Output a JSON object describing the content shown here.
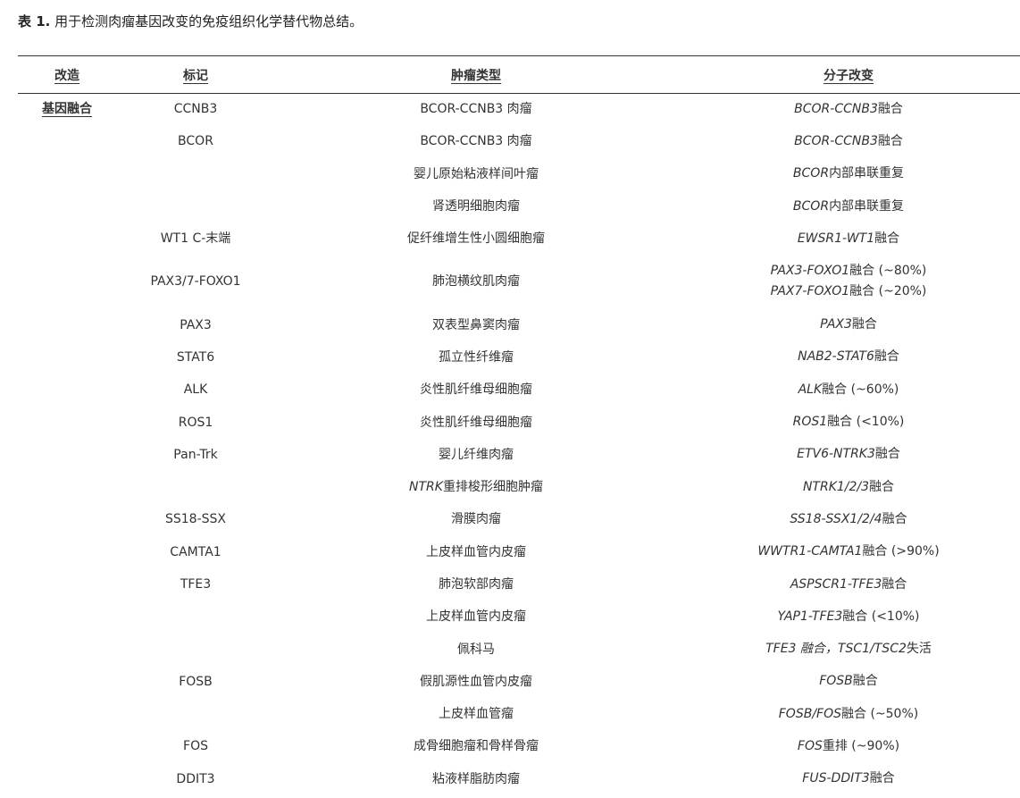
{
  "caption": {
    "label": "表 1.",
    "text": " 用于检测肉瘤基因改变的免疫组织化学替代物总结。"
  },
  "table": {
    "headers": [
      "改造",
      "标记",
      "肿瘤类型",
      "分子改变"
    ],
    "rows": [
      {
        "alteration": "基因融合",
        "marker": "CCNB3",
        "tumor": [
          {
            "t": "BCOR-CCNB3 肉瘤",
            "i": false
          }
        ],
        "molecular": [
          [
            {
              "t": "BCOR-CCNB3",
              "i": true
            },
            {
              "t": "融合",
              "i": false
            }
          ]
        ]
      },
      {
        "alteration": "",
        "marker": "BCOR",
        "tumor": [
          {
            "t": "BCOR-CCNB3 肉瘤",
            "i": false
          }
        ],
        "molecular": [
          [
            {
              "t": "BCOR-CCNB3",
              "i": true
            },
            {
              "t": "融合",
              "i": false
            }
          ]
        ]
      },
      {
        "alteration": "",
        "marker": "",
        "tumor": [
          {
            "t": "婴儿原始粘液样间叶瘤",
            "i": false
          }
        ],
        "molecular": [
          [
            {
              "t": "BCOR",
              "i": true
            },
            {
              "t": "内部串联重复",
              "i": false
            }
          ]
        ]
      },
      {
        "alteration": "",
        "marker": "",
        "tumor": [
          {
            "t": "肾透明细胞肉瘤",
            "i": false
          }
        ],
        "molecular": [
          [
            {
              "t": "BCOR",
              "i": true
            },
            {
              "t": "内部串联重复",
              "i": false
            }
          ]
        ]
      },
      {
        "alteration": "",
        "marker": "WT1 C-末端",
        "tumor": [
          {
            "t": "促纤维增生性小圆细胞瘤",
            "i": false
          }
        ],
        "molecular": [
          [
            {
              "t": "EWSR1-WT1",
              "i": true
            },
            {
              "t": "融合",
              "i": false
            }
          ]
        ]
      },
      {
        "alteration": "",
        "marker": "PAX3/7-FOXO1",
        "tumor": [
          {
            "t": "肺泡横纹肌肉瘤",
            "i": false
          }
        ],
        "molecular": [
          [
            {
              "t": "PAX3-FOXO1",
              "i": true
            },
            {
              "t": "融合 (~80%)",
              "i": false
            }
          ],
          [
            {
              "t": "PAX7-FOXO1",
              "i": true
            },
            {
              "t": "融合 (~20%)",
              "i": false
            }
          ]
        ]
      },
      {
        "alteration": "",
        "marker": "PAX3",
        "tumor": [
          {
            "t": "双表型鼻窦肉瘤",
            "i": false
          }
        ],
        "molecular": [
          [
            {
              "t": "PAX3",
              "i": true
            },
            {
              "t": "融合",
              "i": false
            }
          ]
        ]
      },
      {
        "alteration": "",
        "marker": "STAT6",
        "tumor": [
          {
            "t": "孤立性纤维瘤",
            "i": false
          }
        ],
        "molecular": [
          [
            {
              "t": "NAB2-STAT6",
              "i": true
            },
            {
              "t": "融合",
              "i": false
            }
          ]
        ]
      },
      {
        "alteration": "",
        "marker": "ALK",
        "tumor": [
          {
            "t": "炎性肌纤维母细胞瘤",
            "i": false
          }
        ],
        "molecular": [
          [
            {
              "t": "ALK",
              "i": true
            },
            {
              "t": "融合 (~60%)",
              "i": false
            }
          ]
        ]
      },
      {
        "alteration": "",
        "marker": "ROS1",
        "tumor": [
          {
            "t": "炎性肌纤维母细胞瘤",
            "i": false
          }
        ],
        "molecular": [
          [
            {
              "t": "ROS1",
              "i": true
            },
            {
              "t": "融合 (<10%)",
              "i": false
            }
          ]
        ]
      },
      {
        "alteration": "",
        "marker": "Pan-Trk",
        "tumor": [
          {
            "t": "婴儿纤维肉瘤",
            "i": false
          }
        ],
        "molecular": [
          [
            {
              "t": "ETV6-NTRK3",
              "i": true
            },
            {
              "t": "融合",
              "i": false
            }
          ]
        ]
      },
      {
        "alteration": "",
        "marker": "",
        "tumor": [
          {
            "t": "NTRK",
            "i": true
          },
          {
            "t": "重排梭形细胞肿瘤",
            "i": false
          }
        ],
        "molecular": [
          [
            {
              "t": "NTRK1/2/3",
              "i": true
            },
            {
              "t": "融合",
              "i": false
            }
          ]
        ]
      },
      {
        "alteration": "",
        "marker": "SS18-SSX",
        "tumor": [
          {
            "t": "滑膜肉瘤",
            "i": false
          }
        ],
        "molecular": [
          [
            {
              "t": "SS18-SSX1/2/4",
              "i": true
            },
            {
              "t": "融合",
              "i": false
            }
          ]
        ]
      },
      {
        "alteration": "",
        "marker": "CAMTA1",
        "tumor": [
          {
            "t": "上皮样血管内皮瘤",
            "i": false
          }
        ],
        "molecular": [
          [
            {
              "t": "WWTR1-CAMTA1",
              "i": true
            },
            {
              "t": "融合 (>90%)",
              "i": false
            }
          ]
        ]
      },
      {
        "alteration": "",
        "marker": "TFE3",
        "tumor": [
          {
            "t": "肺泡软部肉瘤",
            "i": false
          }
        ],
        "molecular": [
          [
            {
              "t": "ASPSCR1-TFE3",
              "i": true
            },
            {
              "t": "融合",
              "i": false
            }
          ]
        ]
      },
      {
        "alteration": "",
        "marker": "",
        "tumor": [
          {
            "t": "上皮样血管内皮瘤",
            "i": false
          }
        ],
        "molecular": [
          [
            {
              "t": "YAP1-TFE3",
              "i": true
            },
            {
              "t": "融合 (<10%)",
              "i": false
            }
          ]
        ]
      },
      {
        "alteration": "",
        "marker": "",
        "tumor": [
          {
            "t": "佩科马",
            "i": false
          }
        ],
        "molecular": [
          [
            {
              "t": "TFE3 融合，TSC1/TSC2",
              "i": true
            },
            {
              "t": "失活",
              "i": false
            }
          ]
        ]
      },
      {
        "alteration": "",
        "marker": "FOSB",
        "tumor": [
          {
            "t": "假肌源性血管内皮瘤",
            "i": false
          }
        ],
        "molecular": [
          [
            {
              "t": "FOSB",
              "i": true
            },
            {
              "t": "融合",
              "i": false
            }
          ]
        ]
      },
      {
        "alteration": "",
        "marker": "",
        "tumor": [
          {
            "t": "上皮样血管瘤",
            "i": false
          }
        ],
        "molecular": [
          [
            {
              "t": "FOSB/FOS",
              "i": true
            },
            {
              "t": "融合 (~50%)",
              "i": false
            }
          ]
        ]
      },
      {
        "alteration": "",
        "marker": "FOS",
        "tumor": [
          {
            "t": "成骨细胞瘤和骨样骨瘤",
            "i": false
          }
        ],
        "molecular": [
          [
            {
              "t": "FOS",
              "i": true
            },
            {
              "t": "重排 (~90%)",
              "i": false
            }
          ]
        ]
      },
      {
        "alteration": "",
        "marker": "DDIT3",
        "tumor": [
          {
            "t": "粘液样脂肪肉瘤",
            "i": false
          }
        ],
        "molecular": [
          [
            {
              "t": "FUS-DDIT3",
              "i": true
            },
            {
              "t": "融合",
              "i": false
            }
          ]
        ]
      }
    ]
  }
}
